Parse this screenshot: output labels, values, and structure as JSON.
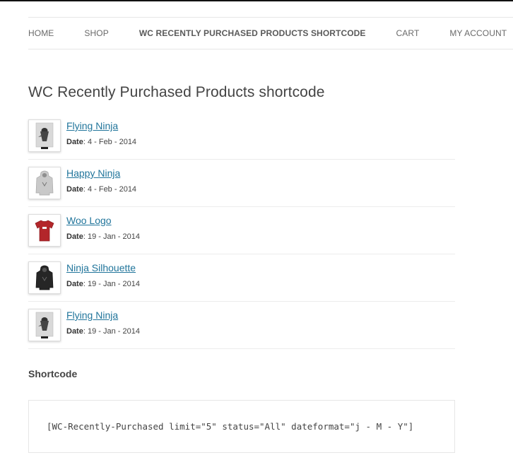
{
  "nav": {
    "items": [
      {
        "label": "HOME",
        "active": false
      },
      {
        "label": "SHOP",
        "active": false
      },
      {
        "label": "WC RECENTLY PURCHASED PRODUCTS SHORTCODE",
        "active": true
      },
      {
        "label": "CART",
        "active": false
      },
      {
        "label": "MY ACCOUNT",
        "active": false
      }
    ]
  },
  "page": {
    "title": "WC Recently Purchased Products shortcode"
  },
  "products": {
    "date_label": "Date",
    "items": [
      {
        "name": "Flying Ninja",
        "date": ": 4 - Feb - 2014",
        "thumb": "poster-ninja-icon"
      },
      {
        "name": "Happy Ninja",
        "date": ": 4 - Feb - 2014",
        "thumb": "grey-hoodie-icon"
      },
      {
        "name": "Woo Logo",
        "date": ": 19 - Jan - 2014",
        "thumb": "red-tshirt-icon"
      },
      {
        "name": "Ninja Silhouette",
        "date": ": 19 - Jan - 2014",
        "thumb": "black-hoodie-icon"
      },
      {
        "name": "Flying Ninja",
        "date": ": 19 - Jan - 2014",
        "thumb": "poster-ninja-icon"
      }
    ]
  },
  "shortcode": {
    "heading": "Shortcode",
    "code": "[WC-Recently-Purchased limit=\"5\" status=\"All\" dateformat=\"j - M - Y\"]"
  },
  "colors": {
    "link": "#21759b",
    "text": "#444444",
    "border": "#e6e6e6"
  }
}
